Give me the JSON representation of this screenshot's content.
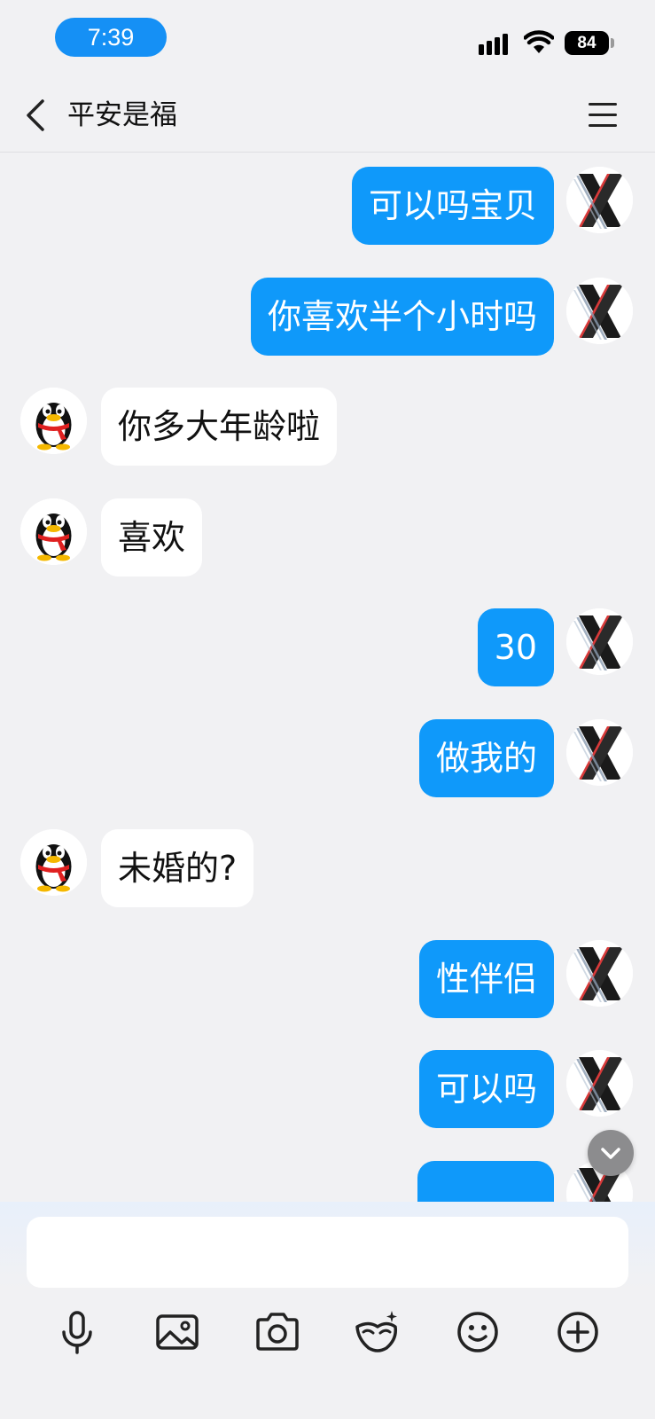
{
  "status_bar": {
    "time": "7:39",
    "battery": "84",
    "accent_color": "#1590f5"
  },
  "header": {
    "title": "平安是福",
    "back_icon": "chevron-left-icon",
    "menu_icon": "hamburger-menu-icon"
  },
  "messages": [
    {
      "side": "out",
      "text": "可以吗宝贝"
    },
    {
      "side": "out",
      "text": "你喜欢半个小时吗"
    },
    {
      "side": "in",
      "text": "你多大年龄啦"
    },
    {
      "side": "in",
      "text": "喜欢"
    },
    {
      "side": "out",
      "text": "30"
    },
    {
      "side": "out",
      "text": "做我的"
    },
    {
      "side": "in",
      "text": "未婚的?"
    },
    {
      "side": "out",
      "text": "性伴侣"
    },
    {
      "side": "out",
      "text": "可以吗"
    },
    {
      "side": "out",
      "text": ""
    }
  ],
  "colors": {
    "outgoing_bubble": "#0f99fa",
    "incoming_bubble": "#ffffff",
    "background": "#f1f1f3"
  },
  "input": {
    "placeholder": "",
    "value": ""
  },
  "toolbar": [
    {
      "icon": "microphone-icon"
    },
    {
      "icon": "image-icon"
    },
    {
      "icon": "camera-icon"
    },
    {
      "icon": "mask-sticker-icon"
    },
    {
      "icon": "emoji-icon"
    },
    {
      "icon": "plus-circle-icon"
    }
  ]
}
